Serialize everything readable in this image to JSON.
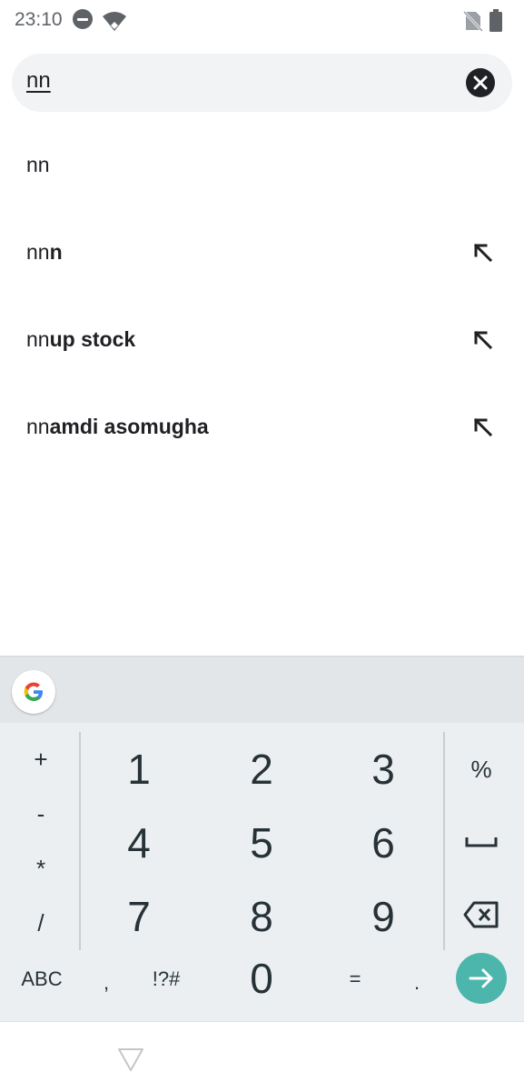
{
  "status_bar": {
    "time": "23:10"
  },
  "search": {
    "query": "nn",
    "clear_icon": "close-icon"
  },
  "suggestions": [
    {
      "prefix": "nn",
      "suffix": "",
      "fill_icon": null
    },
    {
      "prefix": "nn",
      "suffix": "n",
      "fill_icon": "arrow-up-left-icon"
    },
    {
      "prefix": "nn",
      "suffix": "up stock",
      "fill_icon": "arrow-up-left-icon"
    },
    {
      "prefix": "nn",
      "suffix": "amdi asomugha",
      "fill_icon": "arrow-up-left-icon"
    }
  ],
  "keyboard": {
    "left_column": [
      "+",
      "-",
      "*",
      "/"
    ],
    "digits": [
      "1",
      "2",
      "3",
      "4",
      "5",
      "6",
      "7",
      "8",
      "9",
      "0"
    ],
    "right_column": {
      "percent": "%",
      "space_icon": "space-icon",
      "backspace_icon": "backspace-icon"
    },
    "bottom_row": {
      "abc": "ABC",
      "comma": ",",
      "symbols": "!?#",
      "equals": "=",
      "period": "."
    },
    "enter_icon": "arrow-right-icon",
    "accent_color": "#4db6ac"
  }
}
